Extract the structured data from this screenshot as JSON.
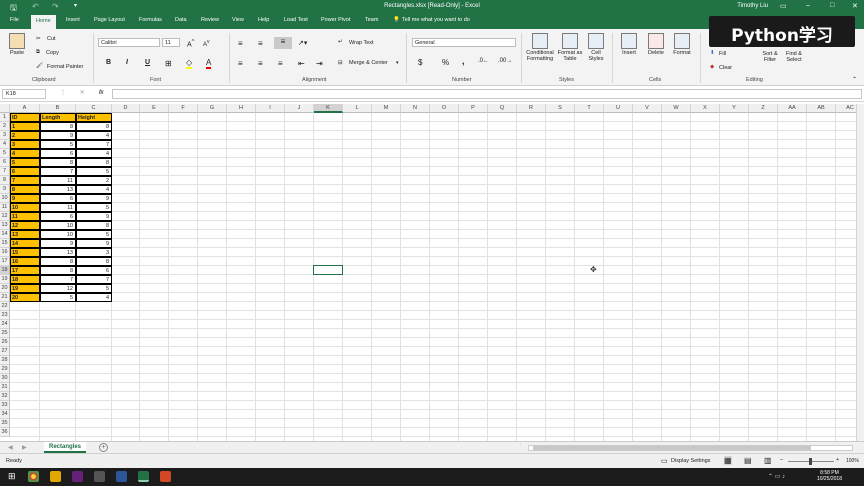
{
  "window": {
    "title": "Rectangles.xlsx  [Read-Only]  -  Excel",
    "user": "Timothy Liu",
    "minimize": "–",
    "maximize": "□",
    "close": "✕"
  },
  "ribbon_tabs": [
    "File",
    "Home",
    "Insert",
    "Page Layout",
    "Formulas",
    "Data",
    "Review",
    "View",
    "Help",
    "Load Test",
    "Power Pivot",
    "Team"
  ],
  "tell_me": "Tell me what you want to do",
  "clipboard": {
    "paste": "Paste",
    "cut": "Cut",
    "copy": "Copy",
    "format_painter": "Format Painter",
    "label": "Clipboard"
  },
  "font": {
    "name": "Calibri",
    "size": "11",
    "bold": "B",
    "italic": "I",
    "underline": "U",
    "label": "Font"
  },
  "alignment": {
    "wrap": "Wrap Text",
    "merge": "Merge & Center",
    "label": "Alignment"
  },
  "number": {
    "format": "General",
    "label": "Number",
    "currency": "$",
    "percent": "%",
    "comma": ","
  },
  "styles": {
    "conditional": "Conditional Formatting",
    "format_table": "Format as Table",
    "cell_styles": "Cell Styles",
    "label": "Styles"
  },
  "cells": {
    "insert": "Insert",
    "delete": "Delete",
    "format": "Format",
    "label": "Cells"
  },
  "editing": {
    "fill": "Fill",
    "clear": "Clear",
    "sort": "Sort & Filter",
    "find": "Find & Select",
    "label": "Editing"
  },
  "watermark": "Python学习",
  "formula_bar": {
    "name_box": "K18",
    "fx": "fx",
    "value": ""
  },
  "columns": [
    "A",
    "B",
    "C",
    "D",
    "E",
    "F",
    "G",
    "H",
    "I",
    "J",
    "K",
    "L",
    "M",
    "N",
    "O",
    "P",
    "Q",
    "R",
    "S",
    "T",
    "U",
    "V",
    "W",
    "X",
    "Y",
    "Z",
    "AA",
    "AB",
    "AC"
  ],
  "rows": [
    "1",
    "2",
    "3",
    "4",
    "5",
    "6",
    "7",
    "8",
    "9",
    "10",
    "11",
    "12",
    "13",
    "14",
    "15",
    "16",
    "17",
    "18",
    "19",
    "20",
    "21",
    "22",
    "23",
    "24",
    "25",
    "26",
    "27",
    "28",
    "29",
    "30",
    "31",
    "32",
    "33",
    "34",
    "35",
    "36"
  ],
  "table": {
    "headers": [
      "ID",
      "Length",
      "Height"
    ],
    "rows": [
      [
        "1",
        "8",
        "8"
      ],
      [
        "2",
        "9",
        "4"
      ],
      [
        "3",
        "5",
        "7"
      ],
      [
        "4",
        "6",
        "4"
      ],
      [
        "5",
        "8",
        "8"
      ],
      [
        "6",
        "7",
        "5"
      ],
      [
        "7",
        "11",
        "2"
      ],
      [
        "8",
        "13",
        "4"
      ],
      [
        "9",
        "6",
        "9"
      ],
      [
        "10",
        "11",
        "5"
      ],
      [
        "11",
        "6",
        "9"
      ],
      [
        "12",
        "10",
        "8"
      ],
      [
        "13",
        "10",
        "5"
      ],
      [
        "14",
        "9",
        "9"
      ],
      [
        "15",
        "13",
        "3"
      ],
      [
        "16",
        "8",
        "8"
      ],
      [
        "17",
        "8",
        "6"
      ],
      [
        "18",
        "7",
        "7"
      ],
      [
        "19",
        "12",
        "5"
      ],
      [
        "20",
        "5",
        "4"
      ]
    ]
  },
  "sheet_tab": "Rectangles",
  "add_sheet": "+",
  "status": {
    "ready": "Ready",
    "display_settings": "Display Settings",
    "zoom": "100%"
  },
  "clock": {
    "time": "8:58 PM",
    "date": "10/25/2018"
  },
  "colors": {
    "excel_green": "#217346",
    "highlight": "#ffc000"
  }
}
